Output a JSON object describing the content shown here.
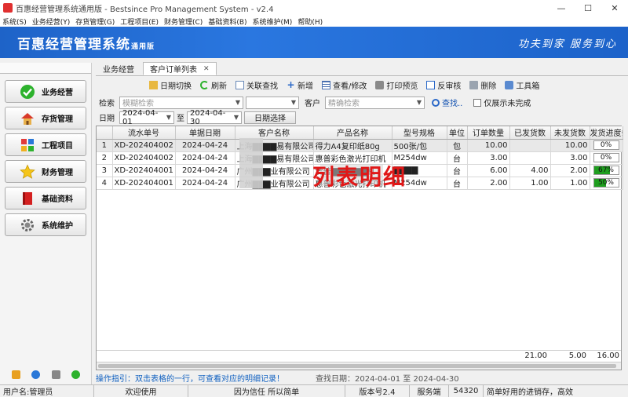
{
  "window": {
    "title": "百惠经营管理系统通用版 - Bestsince Pro Management System - v2.4"
  },
  "menu": [
    "系统(S)",
    "业务经营(Y)",
    "存货管理(G)",
    "工程项目(E)",
    "财务管理(C)",
    "基础资料(B)",
    "系统维护(M)",
    "帮助(H)"
  ],
  "banner": {
    "brand": "百惠经营管理系统",
    "edition": "通用版",
    "slogan": "功夫到家  服务到心"
  },
  "sidebar": {
    "items": [
      {
        "label": "业务经营",
        "icon": "check-icon"
      },
      {
        "label": "存货管理",
        "icon": "house-icon"
      },
      {
        "label": "工程项目",
        "icon": "project-icon"
      },
      {
        "label": "财务管理",
        "icon": "star-icon"
      },
      {
        "label": "基础资料",
        "icon": "book-icon"
      },
      {
        "label": "系统维护",
        "icon": "gear-icon"
      }
    ]
  },
  "tabs": [
    {
      "label": "业务经营"
    },
    {
      "label": "客户订单列表"
    }
  ],
  "toolbar": {
    "date_switch": "日期切换",
    "refresh": "刷新",
    "linked_search": "关联查找",
    "add": "新增",
    "view_edit": "查看/修改",
    "print_preview": "打印预览",
    "unapprove": "反审核",
    "delete": "删除",
    "toolbox": "工具箱"
  },
  "filter": {
    "search_label": "检索",
    "search_placeholder": "模糊检索",
    "customer_label": "客户",
    "customer_placeholder": "精确检索",
    "find_button": "查找..",
    "incomplete_only": "仅展示未完成",
    "date_label": "日期",
    "date_from": "2024-04-01",
    "to_label": "至",
    "date_to": "2024-04-30",
    "date_select_button": "日期选择"
  },
  "table": {
    "columns": [
      "",
      "流水单号",
      "单据日期",
      "客户名称",
      "产品名称",
      "型号规格",
      "单位",
      "订单数量",
      "已发货数",
      "未发货数",
      "发货进度条"
    ],
    "rows": [
      {
        "no": "1",
        "serial": "XD-202404002",
        "date": "2024-04-24",
        "customer": "上海▇▇▇▇易有限公司",
        "product": "得力A4复印纸80g",
        "spec": "500张/包",
        "unit": "包",
        "qty": "10.00",
        "shipped": "",
        "unshipped": "10.00",
        "progress": "0%",
        "progress_value": 0
      },
      {
        "no": "2",
        "serial": "XD-202404002",
        "date": "2024-04-24",
        "customer": "上海▇▇▇▇易有限公司",
        "product": "惠普彩色激光打印机",
        "spec": "M254dw",
        "unit": "台",
        "qty": "3.00",
        "shipped": "",
        "unshipped": "3.00",
        "progress": "0%",
        "progress_value": 0
      },
      {
        "no": "3",
        "serial": "XD-202404001",
        "date": "2024-04-24",
        "customer": "广州▇▇▇业有限公司",
        "product": "爱普▇▇▇▇▇▇机",
        "spec": "▇▇▇▇",
        "unit": "台",
        "qty": "6.00",
        "shipped": "4.00",
        "unshipped": "2.00",
        "progress": "67%",
        "progress_value": 67
      },
      {
        "no": "4",
        "serial": "XD-202404001",
        "date": "2024-04-24",
        "customer": "广州▇▇▇业有限公司",
        "product": "惠普彩色激光打印机",
        "spec": "M254dw",
        "unit": "台",
        "qty": "2.00",
        "shipped": "1.00",
        "unshipped": "1.00",
        "progress": "50%",
        "progress_value": 50
      }
    ],
    "totals": {
      "qty": "21.00",
      "shipped": "5.00",
      "unshipped": "16.00"
    }
  },
  "overlay_text": "列表明细",
  "hint": {
    "guide": "操作指引：双击表格的一行，可查看对应的明细记录！",
    "range": "查找日期：2024-04-01 至 2024-04-30"
  },
  "status": {
    "user": "用户名:管理员",
    "welcome": "欢迎使用",
    "motto": "因为信任 所以简单",
    "version": "版本号2.4",
    "server": "服务端",
    "port": "54320",
    "tagline": "简单好用的进销存，高效"
  },
  "colors": {
    "banner": "#1e63c8",
    "progress": "#1e9e1e",
    "overlay": "#e01818",
    "hint": "#1060c0"
  }
}
